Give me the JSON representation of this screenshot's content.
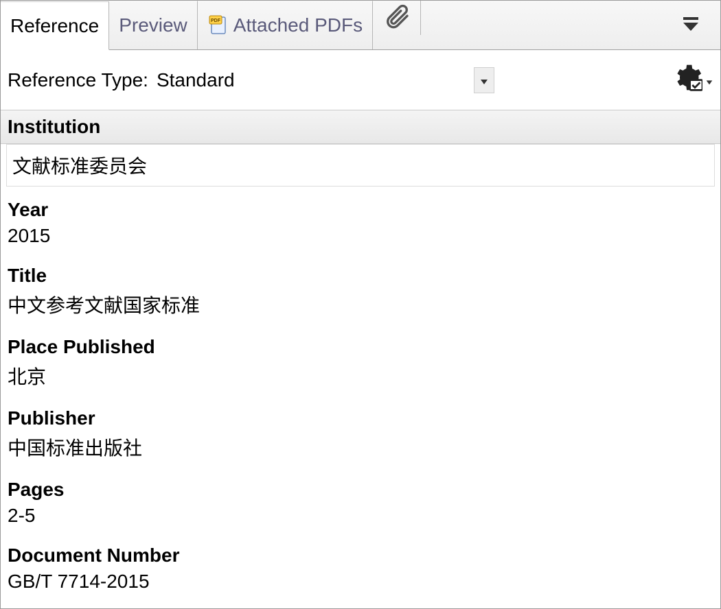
{
  "tabs": {
    "reference": "Reference",
    "preview": "Preview",
    "attached": "Attached PDFs"
  },
  "type_row": {
    "label": "Reference Type:",
    "value": "Standard"
  },
  "fields": [
    {
      "label": "Institution",
      "value": "文献标准委员会",
      "banner": true,
      "boxed": true
    },
    {
      "label": "Year",
      "value": "2015",
      "banner": false,
      "boxed": false
    },
    {
      "label": "Title",
      "value": "中文参考文献国家标准",
      "banner": false,
      "boxed": false
    },
    {
      "label": "Place Published",
      "value": "北京",
      "banner": false,
      "boxed": false
    },
    {
      "label": "Publisher",
      "value": "中国标准出版社",
      "banner": false,
      "boxed": false
    },
    {
      "label": "Pages",
      "value": "2-5",
      "banner": false,
      "boxed": false
    },
    {
      "label": "Document Number",
      "value": "GB/T 7714-2015",
      "banner": false,
      "boxed": false
    }
  ]
}
